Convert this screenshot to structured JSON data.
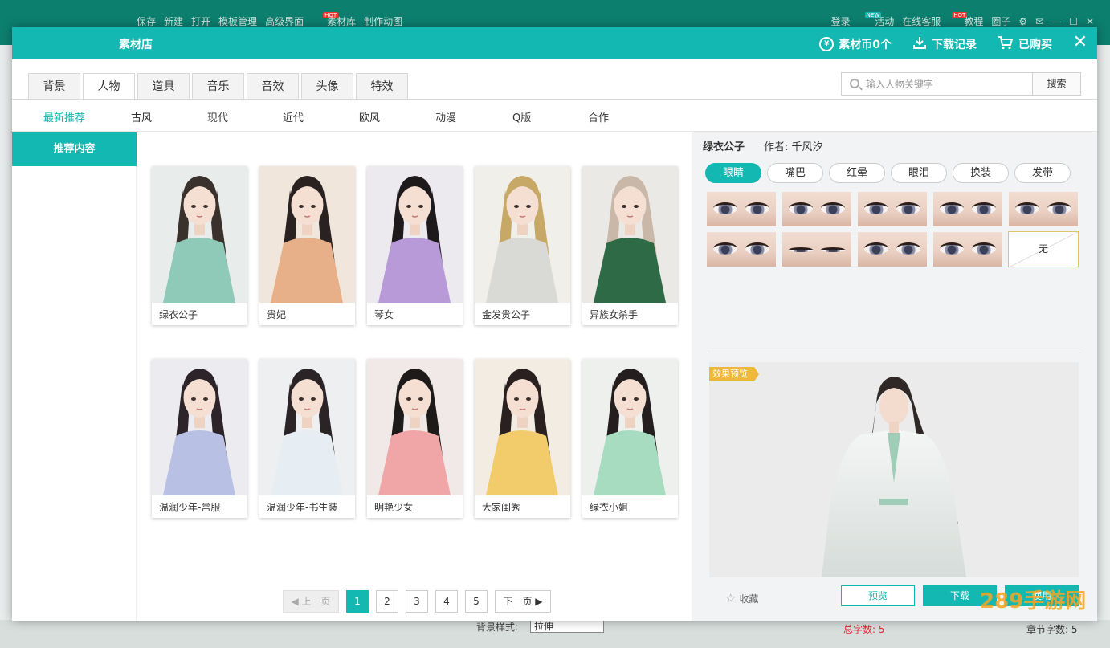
{
  "background_app": {
    "menu": [
      "保存",
      "新建",
      "打开",
      "模板管理",
      "高级界面",
      "素材库",
      "制作动图"
    ],
    "menu_hot_index": 5,
    "right_menu": [
      "登录",
      "活动",
      "在线客服",
      "教程",
      "圈子"
    ],
    "hot_label": "HOT",
    "new_label": "NEW",
    "bg_style_label": "背景样式:",
    "bg_style_value": "拉伸",
    "total_words": "总字数: 5",
    "chapter_words": "章节字数: 5"
  },
  "dialog": {
    "title": "素材店",
    "coins": "素材币0个",
    "download_history": "下载记录",
    "purchased": "已购买",
    "close": "✕"
  },
  "tabs": [
    {
      "label": "背景",
      "active": false
    },
    {
      "label": "人物",
      "active": true
    },
    {
      "label": "道具",
      "active": false
    },
    {
      "label": "音乐",
      "active": false
    },
    {
      "label": "音效",
      "active": false
    },
    {
      "label": "头像",
      "active": false
    },
    {
      "label": "特效",
      "active": false
    }
  ],
  "search": {
    "placeholder": "输入人物关键字",
    "button": "搜索"
  },
  "subcategories": [
    {
      "label": "最新推荐",
      "active": true
    },
    {
      "label": "古风",
      "active": false
    },
    {
      "label": "现代",
      "active": false
    },
    {
      "label": "近代",
      "active": false
    },
    {
      "label": "欧风",
      "active": false
    },
    {
      "label": "动漫",
      "active": false
    },
    {
      "label": "Q版",
      "active": false
    },
    {
      "label": "合作",
      "active": false
    }
  ],
  "sidebar": {
    "items": [
      {
        "label": "推荐内容",
        "active": true
      }
    ]
  },
  "cards": [
    {
      "name": "绿衣公子",
      "robe": "#8fc9b8",
      "hair": "#3a302c",
      "bg": "#e8ecea"
    },
    {
      "name": "贵妃",
      "robe": "#e8b088",
      "hair": "#2a2220",
      "bg": "#f1e6dc"
    },
    {
      "name": "琴女",
      "robe": "#b89ad8",
      "hair": "#1e1a1c",
      "bg": "#eceaee"
    },
    {
      "name": "金发贵公子",
      "robe": "#d9d9d6",
      "hair": "#c8a866",
      "bg": "#f0efea"
    },
    {
      "name": "异族女杀手",
      "robe": "#2f6a46",
      "hair": "#c9b8a8",
      "bg": "#ebe9e6"
    },
    {
      "name": "温润少年-常服",
      "robe": "#b8c0e4",
      "hair": "#2c2428",
      "bg": "#ecebef"
    },
    {
      "name": "温润少年-书生装",
      "robe": "#e6eef4",
      "hair": "#2a2426",
      "bg": "#edeff1"
    },
    {
      "name": "明艳少女",
      "robe": "#f0a6a6",
      "hair": "#1e1a1a",
      "bg": "#f1e8e8"
    },
    {
      "name": "大家闺秀",
      "robe": "#f2cc6a",
      "hair": "#2a2020",
      "bg": "#f2ece2"
    },
    {
      "name": "绿衣小姐",
      "robe": "#a8dcc0",
      "hair": "#241e1e",
      "bg": "#edf0ec"
    }
  ],
  "pagination": {
    "prev": "◀ 上一页",
    "pages": [
      "1",
      "2",
      "3",
      "4",
      "5"
    ],
    "current": "1",
    "next": "下一页 ▶"
  },
  "detail": {
    "name": "绿衣公子",
    "author": "作者: 千风汐",
    "tabs": [
      {
        "label": "眼睛",
        "active": true
      },
      {
        "label": "嘴巴",
        "active": false
      },
      {
        "label": "红晕",
        "active": false
      },
      {
        "label": "眼泪",
        "active": false
      },
      {
        "label": "换装",
        "active": false
      },
      {
        "label": "发带",
        "active": false
      }
    ],
    "eye_variants": [
      "eye-1",
      "eye-2",
      "eye-3",
      "eye-4",
      "eye-5",
      "eye-6",
      "eye-7",
      "eye-8",
      "eye-9"
    ],
    "none_label": "无",
    "preview_badge": "效果预览",
    "favorite": "收藏",
    "preview_button": "预览",
    "download_button": "下载",
    "use_button": "使用"
  },
  "watermark": "289手游网",
  "colors": {
    "accent": "#14b8b2",
    "badge": "#f0b83a"
  }
}
